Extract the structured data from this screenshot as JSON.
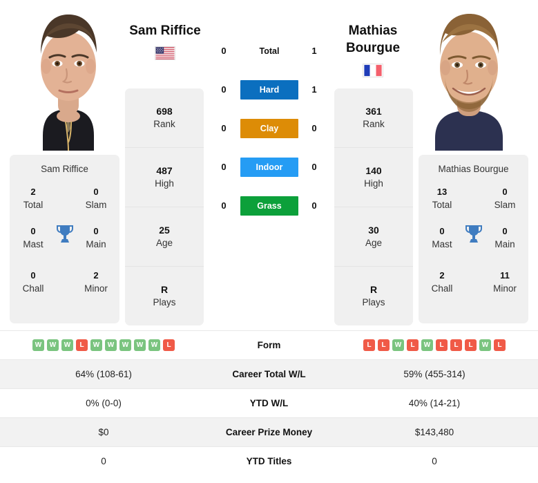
{
  "players": {
    "left": {
      "name": "Sam Riffice",
      "flag": "us-flag-icon",
      "card_name": "Sam Riffice",
      "stats": [
        {
          "value": "698",
          "label": "Rank"
        },
        {
          "value": "487",
          "label": "High"
        },
        {
          "value": "25",
          "label": "Age"
        },
        {
          "value": "R",
          "label": "Plays"
        }
      ],
      "titles": [
        {
          "value": "2",
          "label": "Total"
        },
        {
          "value": "0",
          "label": "Slam"
        },
        {
          "value": "0",
          "label": "Mast"
        },
        {
          "value": "0",
          "label": "Main"
        },
        {
          "value": "0",
          "label": "Chall"
        },
        {
          "value": "2",
          "label": "Minor"
        }
      ],
      "form": [
        "W",
        "W",
        "W",
        "L",
        "W",
        "W",
        "W",
        "W",
        "W",
        "L"
      ]
    },
    "right": {
      "name": "Mathias Bourgue",
      "name_line1": "Mathias",
      "name_line2": "Bourgue",
      "flag": "fr-flag-icon",
      "card_name": "Mathias Bourgue",
      "stats": [
        {
          "value": "361",
          "label": "Rank"
        },
        {
          "value": "140",
          "label": "High"
        },
        {
          "value": "30",
          "label": "Age"
        },
        {
          "value": "R",
          "label": "Plays"
        }
      ],
      "titles": [
        {
          "value": "13",
          "label": "Total"
        },
        {
          "value": "0",
          "label": "Slam"
        },
        {
          "value": "0",
          "label": "Mast"
        },
        {
          "value": "0",
          "label": "Main"
        },
        {
          "value": "2",
          "label": "Chall"
        },
        {
          "value": "11",
          "label": "Minor"
        }
      ],
      "form": [
        "L",
        "L",
        "W",
        "L",
        "W",
        "L",
        "L",
        "L",
        "W",
        "L"
      ]
    }
  },
  "h2h": [
    {
      "label": "Total",
      "left": "0",
      "right": "1",
      "style": "plain",
      "color": ""
    },
    {
      "label": "Hard",
      "left": "0",
      "right": "1",
      "style": "tag",
      "color": "#0b6fbf"
    },
    {
      "label": "Clay",
      "left": "0",
      "right": "0",
      "style": "tag",
      "color": "#dd8c06"
    },
    {
      "label": "Indoor",
      "left": "0",
      "right": "0",
      "style": "tag",
      "color": "#259cf4"
    },
    {
      "label": "Grass",
      "left": "0",
      "right": "0",
      "style": "tag",
      "color": "#0ca03a"
    }
  ],
  "table": [
    {
      "label": "Form",
      "left": "",
      "right": "",
      "type": "form",
      "shade": false
    },
    {
      "label": "Career Total W/L",
      "left": "64% (108-61)",
      "right": "59% (455-314)",
      "type": "text",
      "shade": true
    },
    {
      "label": "YTD W/L",
      "left": "0% (0-0)",
      "right": "40% (14-21)",
      "type": "text",
      "shade": false
    },
    {
      "label": "Career Prize Money",
      "left": "$0",
      "right": "$143,480",
      "type": "text",
      "shade": true
    },
    {
      "label": "YTD Titles",
      "left": "0",
      "right": "0",
      "type": "text",
      "shade": false
    }
  ],
  "colors": {
    "win": "#7ac47f",
    "loss": "#f05a47",
    "hard": "#0b6fbf",
    "clay": "#dd8c06",
    "indoor": "#259cf4",
    "grass": "#0ca03a",
    "panel": "#f0f0f0",
    "row_shade": "#f2f2f2"
  }
}
